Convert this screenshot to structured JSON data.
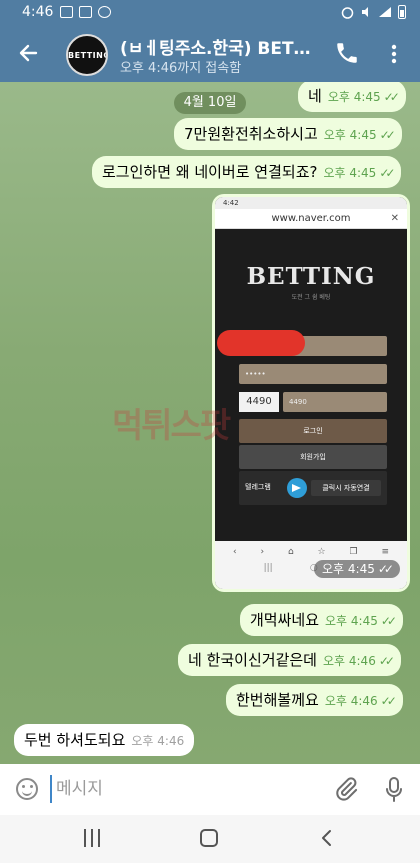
{
  "status_bar": {
    "time": "4:46"
  },
  "header": {
    "title": "(ㅂㅔ팅주소.한국) BET…",
    "subtitle": "오후 4:46까지 접속함",
    "avatar_text": "BETTING"
  },
  "chat": {
    "date_chip": "4월 10일",
    "messages": [
      {
        "text": "네",
        "time": "오후 4:45",
        "dir": "out"
      },
      {
        "text": "7만원환전취소하시고",
        "time": "오후 4:45",
        "dir": "out"
      },
      {
        "text": "로그인하면 왜 네이버로 연결되죠?",
        "time": "오후 4:45",
        "dir": "out"
      },
      {
        "text": "개먹싸네요",
        "time": "오후 4:45",
        "dir": "out"
      },
      {
        "text": "네 한국이신거같은데",
        "time": "오후 4:46",
        "dir": "out"
      },
      {
        "text": "한번해볼께요",
        "time": "오후 4:46",
        "dir": "out"
      },
      {
        "text": "두번 하셔도되요",
        "time": "오후 4:46",
        "dir": "in"
      }
    ],
    "image_message": {
      "time": "오후 4:45",
      "inner": {
        "status_time": "4:42",
        "url": "www.naver.com",
        "logo": "BETTING",
        "logo_sub": "도전 그 쉼 베팅",
        "password_mask": "•••••",
        "captcha": "4490",
        "captcha_input": "4490",
        "login_label": "로그인",
        "signup_label": "회원가입",
        "telegram_label": "텔레그램",
        "telegram_button": "클릭시 자동연결"
      }
    },
    "watermark": "먹튀스팟"
  },
  "input_bar": {
    "placeholder": "메시지"
  }
}
